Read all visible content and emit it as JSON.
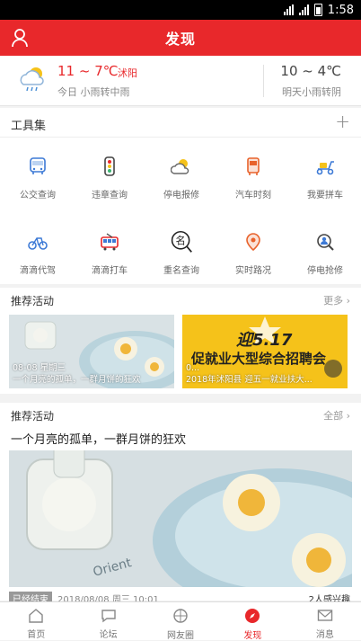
{
  "status_bar": {
    "time": "1:58"
  },
  "header": {
    "title": "发现"
  },
  "weather": {
    "today_temp": "11 ~ 7℃",
    "city": "沭阳",
    "today_desc": "今日 小雨转中雨",
    "tomorrow_temp": "10 ~ 4℃",
    "tomorrow_desc": "明天小雨转阴"
  },
  "tools": {
    "title": "工具集",
    "add_label": "+",
    "items": [
      {
        "label": "公交查询",
        "icon": "bus-icon"
      },
      {
        "label": "违章查询",
        "icon": "traffic-light-icon"
      },
      {
        "label": "停电报修",
        "icon": "weather-icon"
      },
      {
        "label": "汽车时刻",
        "icon": "coach-icon"
      },
      {
        "label": "我要拼车",
        "icon": "scooter-icon"
      },
      {
        "label": "滴滴代驾",
        "icon": "bicycle-icon"
      },
      {
        "label": "滴滴打车",
        "icon": "tram-icon"
      },
      {
        "label": "重名查询",
        "icon": "name-search-icon"
      },
      {
        "label": "实时路况",
        "icon": "location-pin-icon"
      },
      {
        "label": "停电抢修",
        "icon": "magnifier-person-icon"
      }
    ]
  },
  "activities1": {
    "title": "推荐活动",
    "more": "更多",
    "cards": [
      {
        "date": "08-08 星期三",
        "caption": "一个月亮的孤单，一群月饼的狂欢"
      },
      {
        "date": "0...",
        "caption": "2018年沭阳县 迎五一就业扶大...",
        "banner_top": "迎5.17",
        "banner_main": "促就业大型综合招聘会"
      }
    ]
  },
  "activities2": {
    "title": "推荐活动",
    "all": "全部",
    "headline": "一个月亮的孤单，一群月饼的狂欢",
    "badge": "已经结束",
    "date": "2018/08/08 周三 10:01",
    "interest": "2人感兴趣"
  },
  "tabbar": {
    "items": [
      {
        "label": "首页",
        "icon": "home-icon",
        "active": false
      },
      {
        "label": "论坛",
        "icon": "chat-bubble-icon",
        "active": false
      },
      {
        "label": "网友圈",
        "icon": "camera-lens-icon",
        "active": false
      },
      {
        "label": "发现",
        "icon": "compass-icon",
        "active": true
      },
      {
        "label": "消息",
        "icon": "mail-icon",
        "active": false
      }
    ]
  },
  "colors": {
    "brand": "#e8282b",
    "banner_yellow": "#f5c21a"
  }
}
